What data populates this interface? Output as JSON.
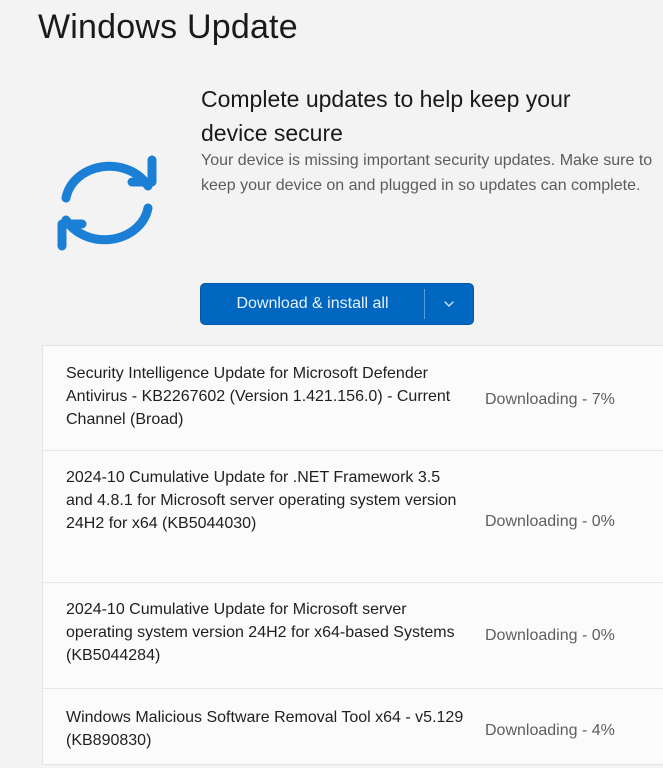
{
  "page": {
    "title": "Windows Update"
  },
  "banner": {
    "icon": "sync-icon",
    "headline": "Complete updates to help keep your device secure",
    "description": "Your device is missing important security updates. Make sure to keep your device on and plugged in so updates can complete.",
    "accent_color": "#1b7fd6"
  },
  "action": {
    "button_label": "Download & install all",
    "dropdown_icon": "chevron-down-icon",
    "button_color": "#0067c0"
  },
  "updates": [
    {
      "name": "Security Intelligence Update for Microsoft Defender Antivirus - KB2267602 (Version 1.421.156.0) - Current Channel (Broad)",
      "status": "Downloading - 7%",
      "progress": 0.07
    },
    {
      "name": "2024-10 Cumulative Update for .NET Framework 3.5 and 4.8.1 for Microsoft server operating system version 24H2 for x64 (KB5044030)",
      "status": "Downloading - 0%",
      "progress": 0.0
    },
    {
      "name": "2024-10 Cumulative Update for Microsoft server operating system version 24H2 for x64-based Systems (KB5044284)",
      "status": "Downloading - 0%",
      "progress": 0.0
    },
    {
      "name": "Windows Malicious Software Removal Tool x64 - v5.129 (KB890830)",
      "status": "Downloading - 4%",
      "progress": 0.04
    }
  ]
}
